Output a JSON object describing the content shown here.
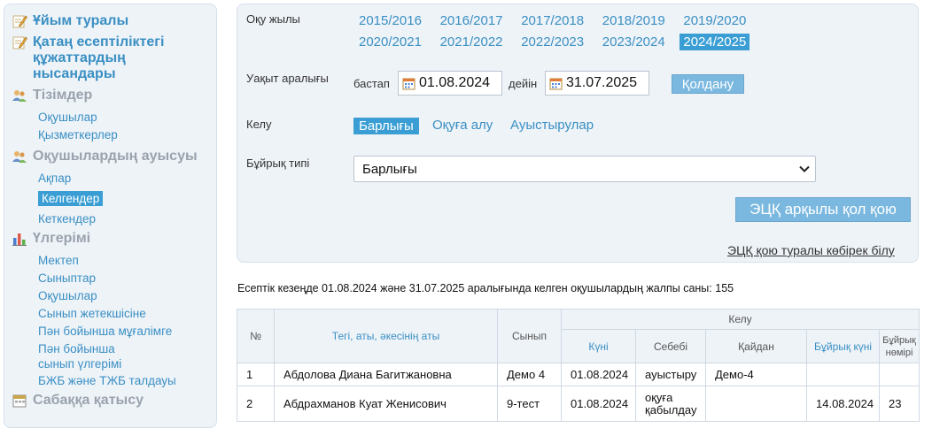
{
  "sidebar": {
    "about": "Ұйым туралы",
    "strict_forms": "Қатаң есептіліктегі құжаттардың нысандары",
    "lists": {
      "title": "Тізімдер",
      "items": [
        "Оқушылар",
        "Қызметкерлер"
      ]
    },
    "movement": {
      "title": "Оқушылардың ауысуы",
      "items": [
        "Ақпар",
        "Келгендер",
        "Кеткендер"
      ],
      "active_index": 1
    },
    "performance": {
      "title": "Үлгерімі",
      "items": [
        "Мектеп",
        "Сыныптар",
        "Оқушылар",
        "Сынып жетекшісіне",
        "Пән бойынша мұғалімге",
        "Пән бойынша сынып үлгерімі",
        "БЖБ және ТЖБ талдауы"
      ]
    },
    "attendance": "Сабаққа қатысу"
  },
  "filters": {
    "year_label": "Оқу жылы",
    "years": [
      "2015/2016",
      "2016/2017",
      "2017/2018",
      "2018/2019",
      "2019/2020",
      "2020/2021",
      "2021/2022",
      "2022/2023",
      "2023/2024",
      "2024/2025"
    ],
    "active_year": "2024/2025",
    "period_label": "Уақыт аралығы",
    "from_label": "бастап",
    "from_value": "01.08.2024",
    "to_label": "дейін",
    "to_value": "31.07.2025",
    "apply_button": "Қолдану",
    "arrival_label": "Келу",
    "arrival_options": [
      "Барлығы",
      "Оқуға алу",
      "Ауыстырулар"
    ],
    "active_arrival": "Барлығы",
    "order_type_label": "Бұйрық типі",
    "order_type_value": "Барлығы",
    "ecp_button": "ЭЦҚ арқылы қол қою",
    "ecp_more_link": "ЭЦҚ қою туралы көбірек білу"
  },
  "report": {
    "summary": "Есептік кезеңде 01.08.2024 және 31.07.2025 аралығында келген оқушылардың жалпы саны: 155",
    "headers": {
      "num": "№",
      "name": "Тегі, аты, әкесінің аты",
      "class": "Сынып",
      "arrival_group": "Келу",
      "date": "Күні",
      "reason": "Себебі",
      "from": "Қайдан",
      "order_date": "Бұйрық күні",
      "order_number": "Бұйрық нөмірі"
    },
    "rows": [
      {
        "num": "1",
        "name": "Абдолова Диана Багитжановна",
        "class": "Демо 4",
        "date": "01.08.2024",
        "reason": "ауыстыру",
        "from": "Демо-4",
        "order_date": "",
        "order_number": ""
      },
      {
        "num": "2",
        "name": "Абдрахманов Куат Женисович",
        "class": "9-тест",
        "date": "01.08.2024",
        "reason": "оқуға қабылдау",
        "from": "",
        "order_date": "14.08.2024",
        "order_number": "23"
      }
    ]
  },
  "colors": {
    "accent": "#3a8fc3",
    "active_bg": "#3a9ed4",
    "button_bg": "#7ab8e0",
    "panel_bg": "#eef3f8"
  }
}
